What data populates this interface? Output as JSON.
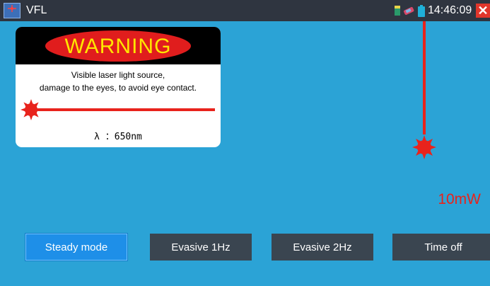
{
  "statusbar": {
    "title": "VFL",
    "clock": "14:46:09",
    "app_icon": "vfl-app-icon",
    "icons": [
      "signal-icon",
      "usb-icon",
      "battery-icon"
    ],
    "close_icon": "close-icon"
  },
  "warning": {
    "heading": "WARNING",
    "line1": "Visible laser light source,",
    "line2": "damage to the eyes, to avoid eye contact.",
    "wavelength": "λ ：650nm"
  },
  "laser": {
    "power": "10mW",
    "color": "#e8231c"
  },
  "modes": [
    {
      "label": "Steady mode",
      "selected": true
    },
    {
      "label": "Evasive 1Hz",
      "selected": false
    },
    {
      "label": "Evasive 2Hz",
      "selected": false
    },
    {
      "label": "Time off",
      "selected": false
    }
  ],
  "colors": {
    "background": "#2ba3d6",
    "statusbar": "#2f3540",
    "button": "#3a4550",
    "button_selected": "#1e8fe8",
    "warning_yellow": "#ffe600",
    "warning_red": "#e01d1d"
  }
}
